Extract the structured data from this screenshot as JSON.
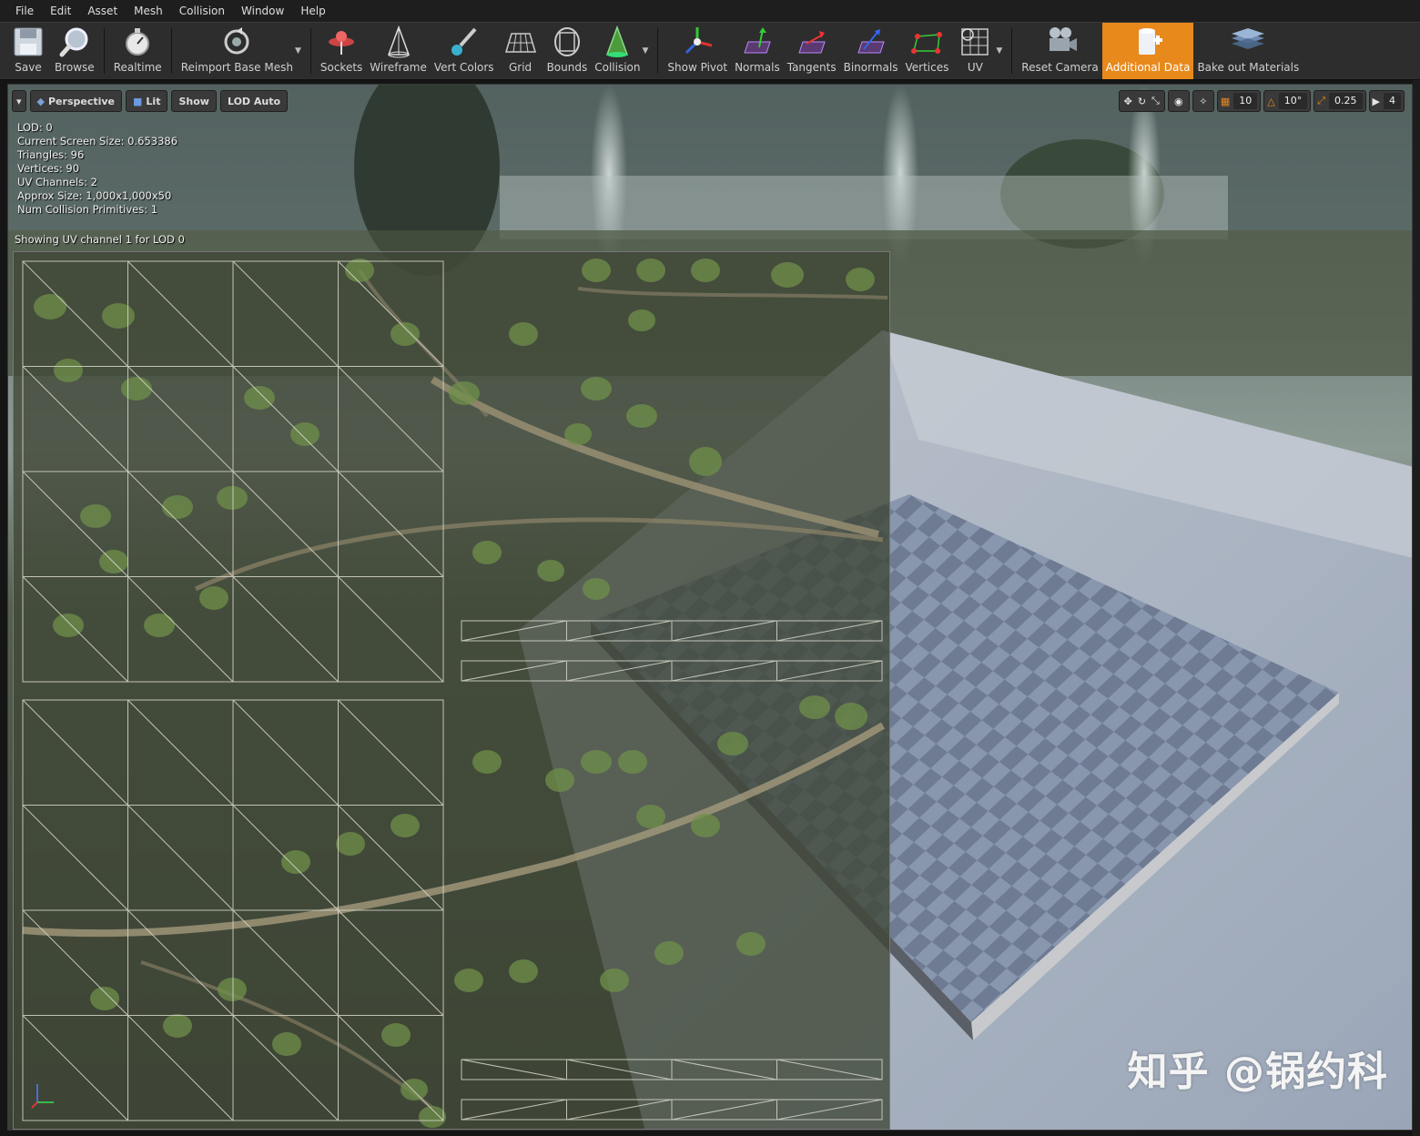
{
  "menu": [
    "File",
    "Edit",
    "Asset",
    "Mesh",
    "Collision",
    "Window",
    "Help"
  ],
  "toolbar": {
    "save": "Save",
    "browse": "Browse",
    "realtime": "Realtime",
    "reimport": "Reimport Base Mesh",
    "sockets": "Sockets",
    "wireframe": "Wireframe",
    "vert_colors": "Vert Colors",
    "grid": "Grid",
    "bounds": "Bounds",
    "collision": "Collision",
    "show_pivot": "Show Pivot",
    "normals": "Normals",
    "tangents": "Tangents",
    "binormals": "Binormals",
    "vertices": "Vertices",
    "uv": "UV",
    "reset_camera": "Reset Camera",
    "additional_data": "Additional Data",
    "bake_out": "Bake out Materials"
  },
  "viewport": {
    "perspective": "Perspective",
    "lit": "Lit",
    "show": "Show",
    "lod": "LOD Auto",
    "grid_snap": "10",
    "rot_snap": "10°",
    "scale_snap": "0.25",
    "cam_speed": "4"
  },
  "stats": {
    "lod": "LOD:  0",
    "screen_size": "Current Screen Size:  0.653386",
    "triangles": "Triangles:  96",
    "vertices": "Vertices:  90",
    "uv_channels": "UV Channels:  2",
    "approx_size": "Approx Size: 1,000x1,000x50",
    "collision_prims": "Num Collision Primitives:  1"
  },
  "uv_message": "Showing UV channel 1 for LOD 0",
  "watermark": "知乎 @锅约科",
  "colors": {
    "accent": "#e8891c",
    "toolbar_bg": "#2d2d2d",
    "menubar_bg": "#1e1e1e"
  }
}
